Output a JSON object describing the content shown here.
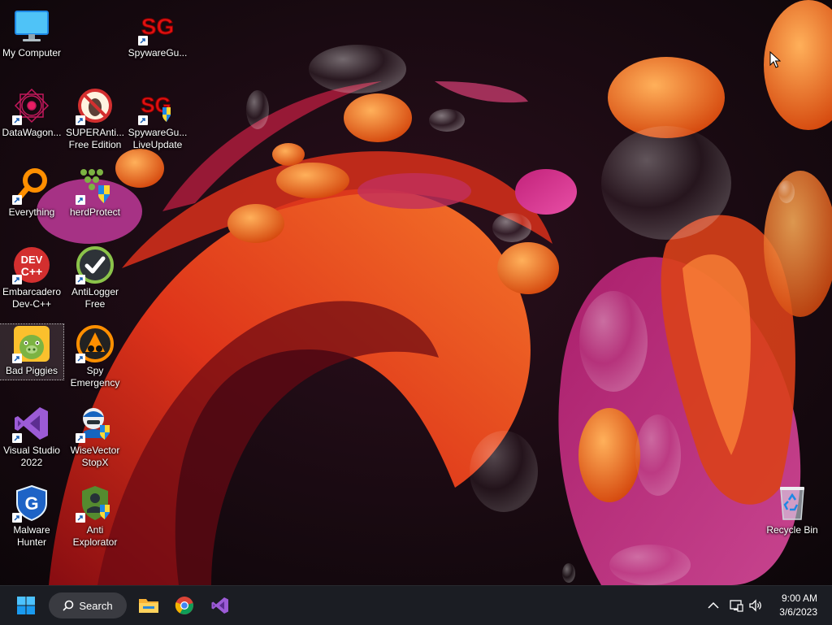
{
  "desktop": {
    "icons": [
      {
        "name": "my-computer",
        "label": "My Computer",
        "icon": "monitor-icon",
        "shortcut": false
      },
      {
        "name": "spywareguard",
        "label": "SpywareGu...",
        "icon": "sg-icon",
        "shortcut": true
      },
      {
        "name": "datawagon",
        "label": "DataWagon...",
        "icon": "datawagon-icon",
        "shortcut": true
      },
      {
        "name": "superantispyware",
        "label": "SUPERAnti...\nFree Edition",
        "icon": "superantispyware-icon",
        "shortcut": true
      },
      {
        "name": "spywareguard-liveupdate",
        "label": "SpywareGu...\nLiveUpdate",
        "icon": "sg-shield-icon",
        "shortcut": true
      },
      {
        "name": "everything",
        "label": "Everything",
        "icon": "magnifier-icon",
        "shortcut": true
      },
      {
        "name": "herdprotect",
        "label": "herdProtect",
        "icon": "herdprotect-icon",
        "shortcut": true
      },
      {
        "name": "embarcadero-devcpp",
        "label": "Embarcadero\nDev-C++",
        "icon": "devcpp-icon",
        "shortcut": true
      },
      {
        "name": "antilogger",
        "label": "AntiLogger\nFree",
        "icon": "checkmark-icon",
        "shortcut": true
      },
      {
        "name": "bad-piggies",
        "label": "Bad Piggies",
        "icon": "pig-icon",
        "shortcut": true
      },
      {
        "name": "spy-emergency",
        "label": "Spy\nEmergency",
        "icon": "spy-emergency-icon",
        "shortcut": true
      },
      {
        "name": "visual-studio-2022",
        "label": "Visual Studio\n2022",
        "icon": "visual-studio-icon",
        "shortcut": true
      },
      {
        "name": "wisevector-stopx",
        "label": "WiseVector\nStopX",
        "icon": "wisevector-icon",
        "shortcut": true
      },
      {
        "name": "malware-hunter",
        "label": "Malware\nHunter",
        "icon": "shield-g-icon",
        "shortcut": true
      },
      {
        "name": "anti-explorator",
        "label": "Anti\nExplorator",
        "icon": "anti-explorator-icon",
        "shortcut": true
      },
      {
        "name": "recycle-bin",
        "label": "Recycle Bin",
        "icon": "recycle-bin-icon",
        "shortcut": false
      }
    ],
    "selected": "bad-piggies"
  },
  "taskbar": {
    "start_icon": "windows-start-icon",
    "search_label": "Search",
    "pinned": [
      {
        "name": "file-explorer",
        "icon": "folder-icon"
      },
      {
        "name": "google-chrome",
        "icon": "chrome-icon"
      },
      {
        "name": "visual-studio",
        "icon": "visual-studio-icon"
      }
    ],
    "tray": {
      "icons": [
        "chevron-up-icon",
        "network-icon",
        "volume-icon"
      ],
      "time": "9:00 AM",
      "date": "3/6/2023"
    }
  },
  "colors": {
    "taskbar": "#1c1e24",
    "accent": "#0078d4"
  }
}
